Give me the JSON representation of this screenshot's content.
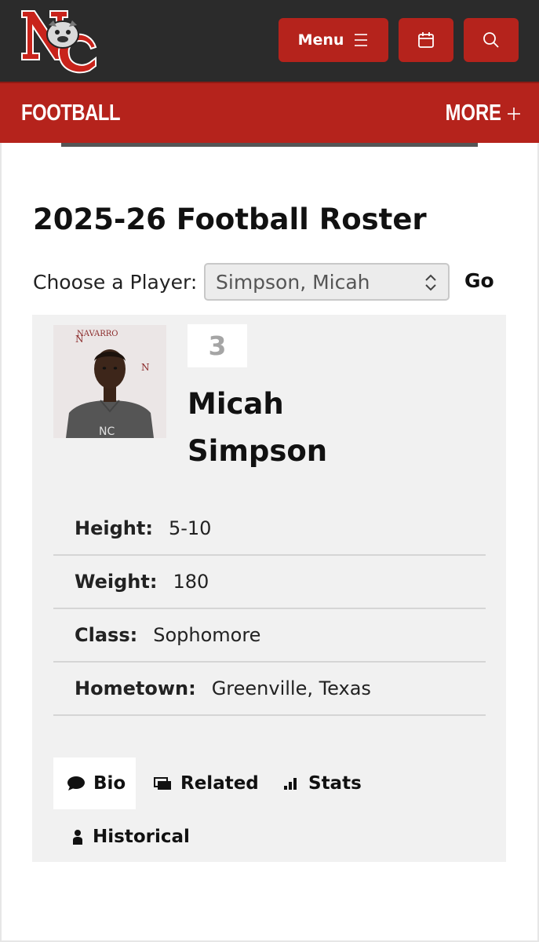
{
  "header": {
    "logo_name": "college-logo",
    "menu_label": "Menu",
    "menu_icon": "hamburger-icon",
    "calendar_icon": "calendar-icon",
    "search_icon": "search-icon",
    "accent_color": "#b5231c",
    "bar_color": "#2b2b2b"
  },
  "sport_bar": {
    "title": "FOOTBALL",
    "more_label": "MORE",
    "more_icon": "plus-icon"
  },
  "roster": {
    "title": "2025-26 Football Roster",
    "choose_label": "Choose a Player:",
    "selected_player": "Simpson, Micah",
    "go_label": "Go"
  },
  "player": {
    "number": "3",
    "name": "Micah Simpson",
    "bio": [
      {
        "key": "Height:",
        "value": "5-10"
      },
      {
        "key": "Weight:",
        "value": "180"
      },
      {
        "key": "Class:",
        "value": "Sophomore"
      },
      {
        "key": "Hometown:",
        "value": "Greenville, Texas"
      }
    ]
  },
  "tabs": [
    {
      "label": "Bio",
      "icon": "speech-bubble-icon",
      "active": true
    },
    {
      "label": "Related",
      "icon": "stacked-cards-icon",
      "active": false
    },
    {
      "label": "Stats",
      "icon": "bar-chart-icon",
      "active": false
    },
    {
      "label": "Historical",
      "icon": "person-icon",
      "active": false
    }
  ]
}
